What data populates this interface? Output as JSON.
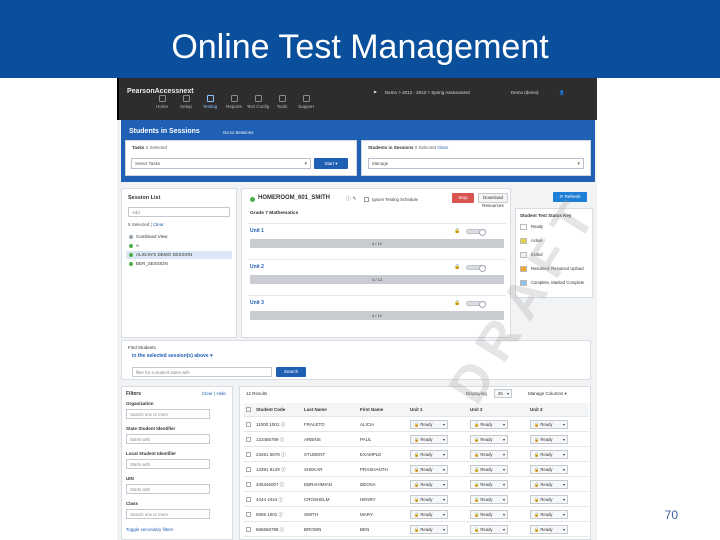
{
  "slide": {
    "title": "Online Test Management",
    "page_number": "70",
    "watermark": "DRAFT"
  },
  "app": {
    "brand": "PearsonAccessnext",
    "nav": [
      {
        "label": "Home",
        "icon": "home-icon"
      },
      {
        "label": "Setup",
        "icon": "gear-icon"
      },
      {
        "label": "Testing",
        "icon": "checklist-icon",
        "active": true
      },
      {
        "label": "Reports",
        "icon": "chart-icon"
      },
      {
        "label": "Test Config",
        "icon": "monitor-icon"
      },
      {
        "label": "Tools",
        "icon": "wrench-icon"
      },
      {
        "label": "Support",
        "icon": "question-icon"
      }
    ],
    "context": "Demo > 2012 - 2013 > Spring Assessment",
    "user": "Demo (demo)"
  },
  "students_in_sessions": {
    "title": "Students in Sessions",
    "goto": "Go to Sessions",
    "tasks": {
      "label": "Tasks",
      "count": "0 Selected",
      "select_placeholder": "Select Tasks",
      "start_label": "Start"
    },
    "sis": {
      "label": "Students in Sessions",
      "count": "0 Selected",
      "clear": "Clear",
      "manage": "Manage"
    }
  },
  "session_list": {
    "title": "Session List",
    "add_placeholder": "Add",
    "selected": "5 Selected",
    "clear": "Clear",
    "items": [
      {
        "label": "Combined View",
        "dot": "#9aa3ab"
      },
      {
        "label": "A",
        "dot": "#4cae4c"
      },
      {
        "label": "ALIGAN'S DEMO SESSION",
        "dot": "#4cae4c"
      },
      {
        "label": "BER_SESSION",
        "dot": "#4cae4c"
      }
    ]
  },
  "session_detail": {
    "name": "HOMEROOM_601_SMITH",
    "ignore_label": "Ignore Testing Schedule",
    "stop_label": "Stop",
    "download_label": "Download Resources",
    "refresh_label": "Refresh",
    "subject": "Grade 7 Mathematics",
    "units": [
      {
        "name": "Unit 1",
        "progress": "4 / 12"
      },
      {
        "name": "Unit 2",
        "progress": "4 / 12"
      },
      {
        "name": "Unit 3",
        "progress": "4 / 12"
      }
    ]
  },
  "status_key": {
    "title": "Student Test Status Key",
    "items": [
      {
        "label": "Ready",
        "color": "#ffffff"
      },
      {
        "label": "Active",
        "color": "#e6d24a"
      },
      {
        "label": "Exited",
        "color": "#f1f1f1"
      },
      {
        "label": "Resumed, Resumed Upload",
        "color": "#f0a830"
      },
      {
        "label": "Complete, Marked Complete",
        "color": "#8fc4ea"
      }
    ]
  },
  "find_students": {
    "title": "Find Students",
    "scope": "in the selected session(s) above",
    "search_placeholder": "filter for a student starts with",
    "search_label": "Search"
  },
  "filters": {
    "title": "Filters",
    "clear": "Clear",
    "hide": "Hide",
    "groups": [
      {
        "label": "Organization",
        "placeholder": "Search one or more"
      },
      {
        "label": "State Student Identifier",
        "placeholder": "Starts with"
      },
      {
        "label": "Local Student Identifier",
        "placeholder": "Starts with"
      },
      {
        "label": "UIN",
        "placeholder": "Starts with"
      },
      {
        "label": "Class",
        "placeholder": "Search one or more"
      }
    ],
    "toggle_secondary": "Toggle secondary filters"
  },
  "results": {
    "count": "12 Results",
    "displaying_label": "Displaying",
    "displaying_value": "25",
    "manage_columns": "Manage Columns",
    "columns": [
      "Student Code",
      "Last Name",
      "First Name",
      "Unit 1",
      "Unit 2",
      "Unit 3"
    ],
    "rows": [
      {
        "code": "11000 1001",
        "last": "FRALETO",
        "first": "ALICIA",
        "u1": "Ready",
        "u2": "Ready",
        "u3": "Ready"
      },
      {
        "code": "123456789",
        "last": "ARBINS",
        "first": "PAUL",
        "u1": "Ready",
        "u2": "Ready",
        "u3": "Ready"
      },
      {
        "code": "23451 5678",
        "last": "STUDENT",
        "first": "EXAMPLE",
        "u1": "Ready",
        "u2": "Ready",
        "u3": "Ready"
      },
      {
        "code": "13391 9129",
        "last": "SHEKAR",
        "first": "PRASHANTH",
        "u1": "Ready",
        "u2": "Ready",
        "u3": "Ready"
      },
      {
        "code": "345345007",
        "last": "EBRAHIMIAN",
        "first": "DEOSA",
        "u1": "Ready",
        "u2": "Ready",
        "u3": "Ready"
      },
      {
        "code": "4444 4444",
        "last": "CROSHELM",
        "first": "HENRY",
        "u1": "Ready",
        "u2": "Ready",
        "u3": "Ready"
      },
      {
        "code": "5555 1001",
        "last": "SMITH",
        "first": "MARY",
        "u1": "Ready",
        "u2": "Ready",
        "u3": "Ready"
      },
      {
        "code": "666666788",
        "last": "BROWN",
        "first": "BEN",
        "u1": "Ready",
        "u2": "Ready",
        "u3": "Ready"
      }
    ]
  }
}
